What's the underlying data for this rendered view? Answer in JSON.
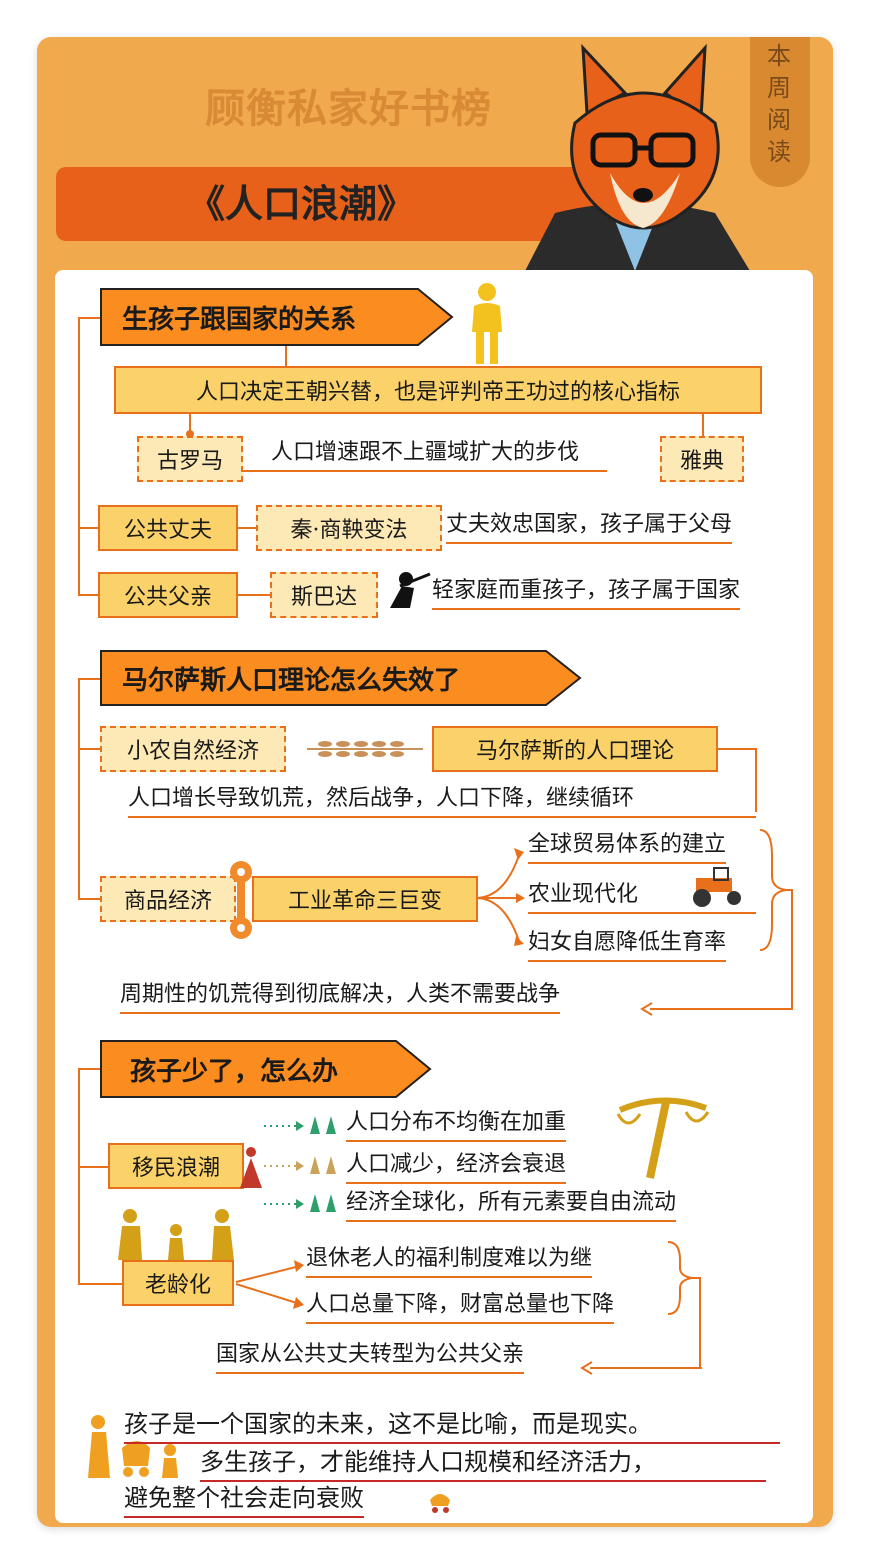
{
  "header": {
    "title": "顾衡私家好书榜",
    "book": "《人口浪潮》",
    "tag_chars": [
      "本",
      "周",
      "阅",
      "读"
    ]
  },
  "section1": {
    "banner": "生孩子跟国家的关系",
    "main": "人口决定王朝兴替，也是评判帝王功过的核心指标",
    "rome": "古罗马",
    "rome_text": "人口增速跟不上疆域扩大的步伐",
    "athens": "雅典",
    "husband": "公共丈夫",
    "qin": "秦·商鞅变法",
    "qin_text": "丈夫效忠国家，孩子属于父母",
    "father": "公共父亲",
    "sparta": "斯巴达",
    "sparta_text": "轻家庭而重孩子，孩子属于国家"
  },
  "section2": {
    "banner": "马尔萨斯人口理论怎么失效了",
    "small_farm": "小农自然经济",
    "malthus": "马尔萨斯的人口理论",
    "cycle": "人口增长导致饥荒，然后战争，人口下降，继续循环",
    "commodity": "商品经济",
    "industrial": "工业革命三巨变",
    "changes": [
      "全球贸易体系的建立",
      "农业现代化",
      "妇女自愿降低生育率"
    ],
    "result": "周期性的饥荒得到彻底解决，人类不需要战争"
  },
  "section3": {
    "banner": "孩子少了，怎么办",
    "migration": "移民浪潮",
    "migration_items": [
      "人口分布不均衡在加重",
      "人口减少，经济会衰退",
      "经济全球化，所有元素要自由流动"
    ],
    "aging": "老龄化",
    "aging_items": [
      "退休老人的福利制度难以为继",
      "人口总量下降，财富总量也下降"
    ],
    "result": "国家从公共丈夫转型为公共父亲"
  },
  "footer": {
    "line1": "孩子是一个国家的未来，这不是比喻，而是现实。",
    "line2": "多生孩子，才能维持人口规模和经济活力，",
    "line3": "避免整个社会走向衰败"
  },
  "colors": {
    "orange": "#e8701a",
    "card": "#f0a94d",
    "box_fill": "#fbd16a",
    "accent_red": "#c62828"
  }
}
